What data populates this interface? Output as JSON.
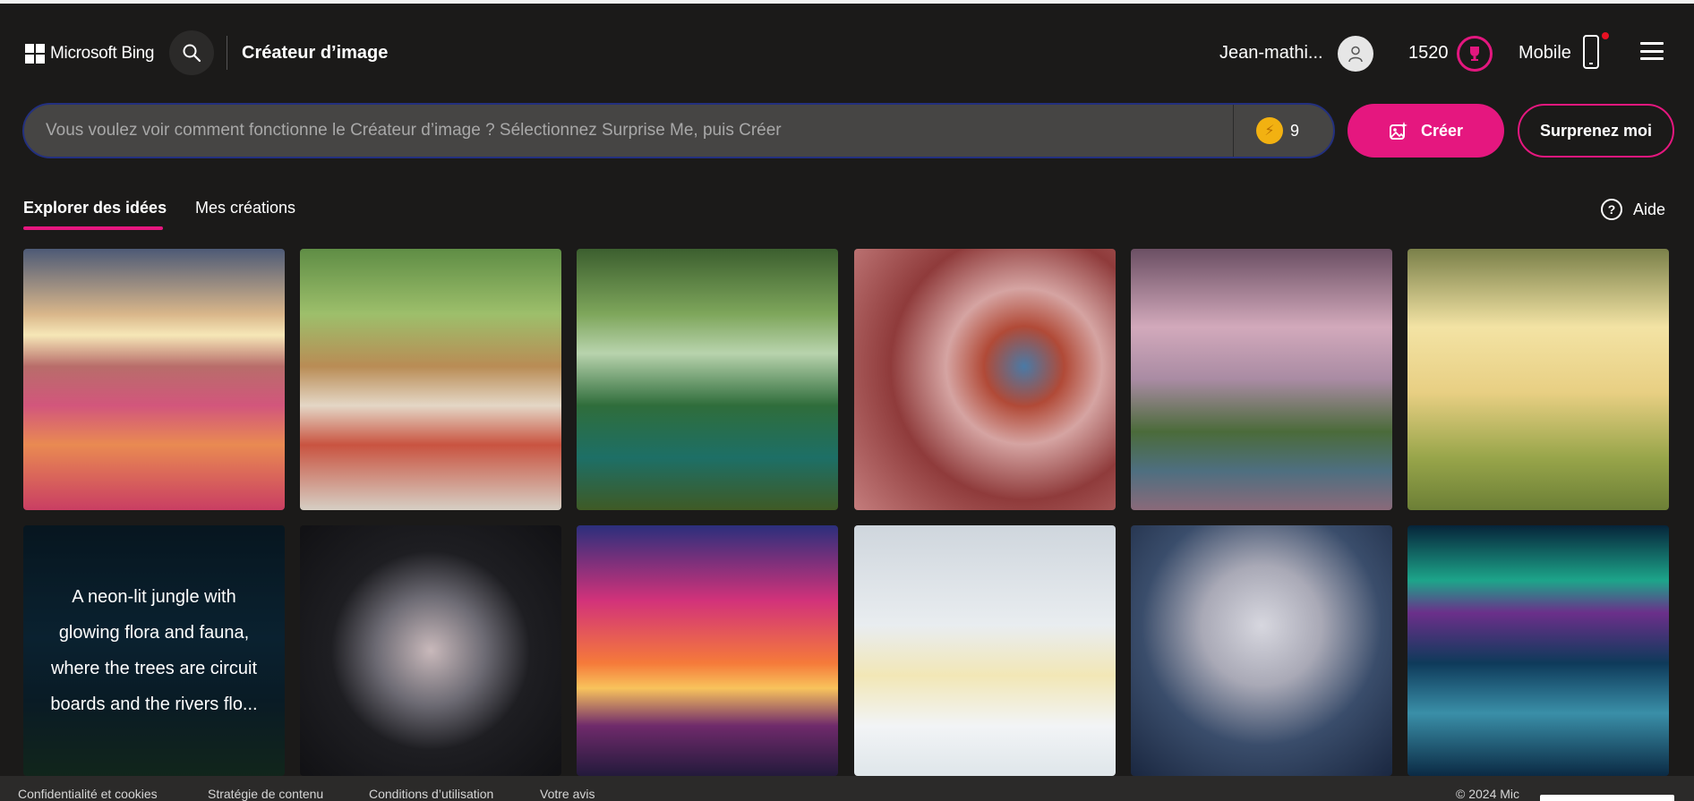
{
  "header": {
    "brand": "Microsoft Bing",
    "app_title": "Créateur d’image",
    "user_name": "Jean-mathi...",
    "points": "1520",
    "mobile_label": "Mobile",
    "icons": {
      "search": "search-icon",
      "avatar": "person-icon",
      "rewards": "trophy-icon",
      "mobile": "phone-icon",
      "menu": "hamburger-icon"
    }
  },
  "prompt": {
    "placeholder": "Vous voulez voir comment fonctionne le Créateur d’image ? Sélectionnez Surprise Me, puis Créer",
    "value": "",
    "boosts": "9",
    "create_label": "Créer",
    "surprise_label": "Surprenez moi"
  },
  "tabs": {
    "explore": "Explorer des idées",
    "mine": "Mes créations",
    "help": "Aide"
  },
  "gallery": [
    {
      "name": "tulip-field-sunset",
      "caption": ""
    },
    {
      "name": "picnic-basket-flowers",
      "caption": ""
    },
    {
      "name": "jungle-waterfall-rainbow",
      "caption": ""
    },
    {
      "name": "butterfly-cherry-blossoms",
      "caption": ""
    },
    {
      "name": "cherry-blossom-river",
      "caption": ""
    },
    {
      "name": "park-kite-children",
      "caption": ""
    },
    {
      "name": "neon-jungle",
      "caption": "A neon-lit jungle with glowing flora and fauna, where the trees are circuit boards and the rivers flo..."
    },
    {
      "name": "crescent-moon-flowers",
      "caption": ""
    },
    {
      "name": "cowboy-sunset-silhouette",
      "caption": ""
    },
    {
      "name": "polar-bears-lemonade",
      "caption": ""
    },
    {
      "name": "silver-flower-bouquet",
      "caption": ""
    },
    {
      "name": "aurora-river",
      "caption": ""
    }
  ],
  "footer": {
    "links": [
      "Confidentialité et cookies",
      "Stratégie de contenu",
      "Conditions d’utilisation",
      "Votre avis"
    ],
    "copyright": "© 2024 Mic"
  },
  "colors": {
    "background": "#1b1a19",
    "accent": "#e5177f",
    "prompt_bg": "#464544",
    "prompt_border": "#23307f"
  }
}
